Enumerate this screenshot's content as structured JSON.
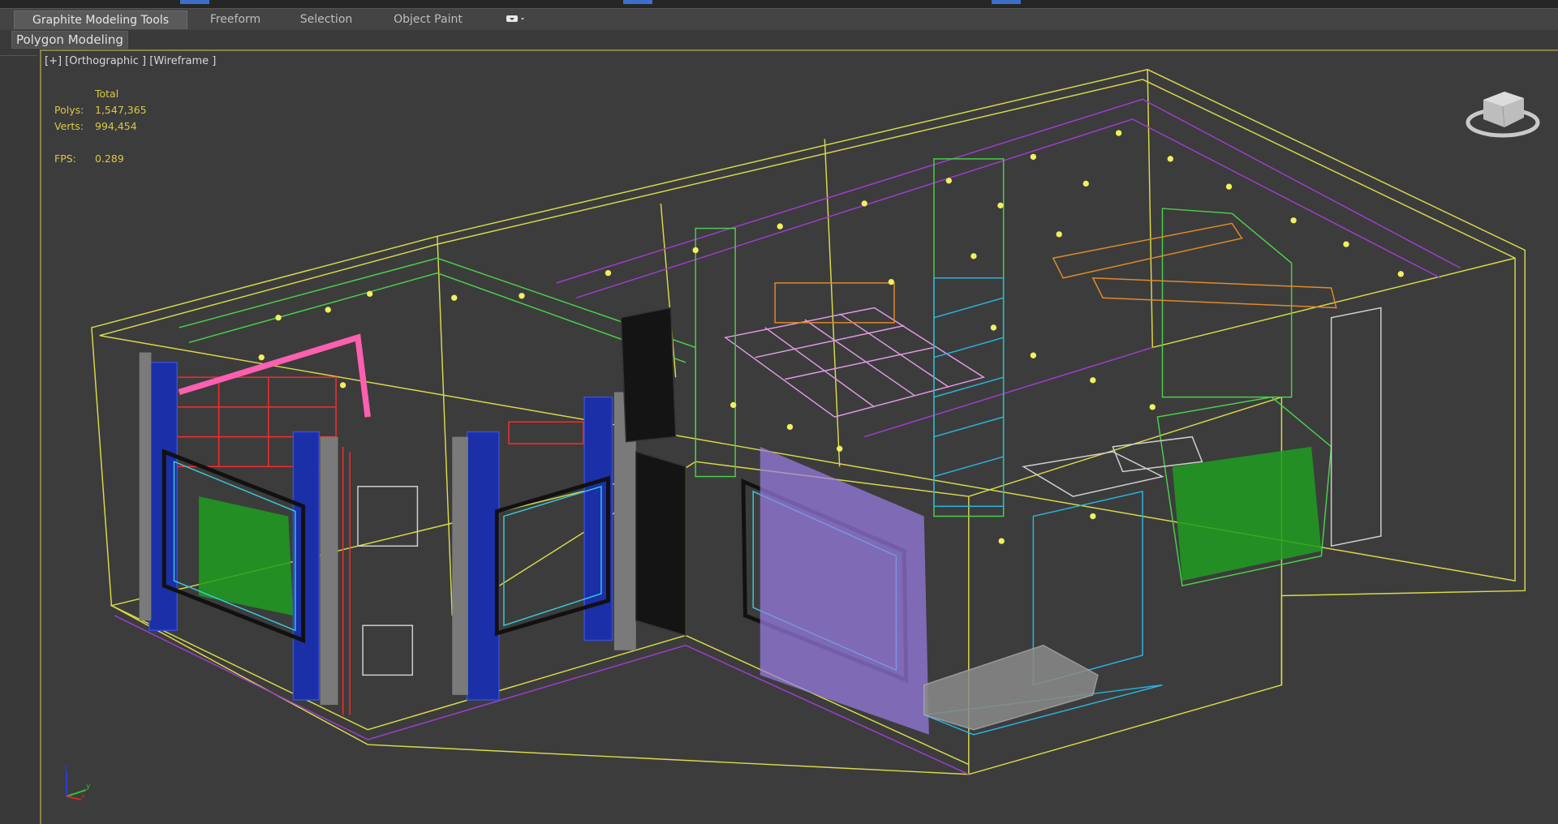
{
  "ribbon": {
    "tabs": [
      {
        "label": "Graphite Modeling Tools",
        "active": true
      },
      {
        "label": "Freeform",
        "active": false
      },
      {
        "label": "Selection",
        "active": false
      },
      {
        "label": "Object Paint",
        "active": false
      }
    ],
    "options_icon": "ribbon-toggle-dropdown-icon",
    "panel_label": "Polygon Modeling"
  },
  "viewport": {
    "label": "[+] [Orthographic ] [Wireframe ]",
    "stats": {
      "header": "Total",
      "polys_label": "Polys:",
      "polys_value": "1,547,365",
      "verts_label": "Verts:",
      "verts_value": "994,454",
      "fps_label": "FPS:",
      "fps_value": "0.289"
    },
    "viewcube_icon": "viewcube-icon",
    "axis_icon": "axis-tripod-icon",
    "colors": {
      "border": "#8d7f46",
      "stats": "#d8c844",
      "background": "#3c3c3c"
    }
  }
}
